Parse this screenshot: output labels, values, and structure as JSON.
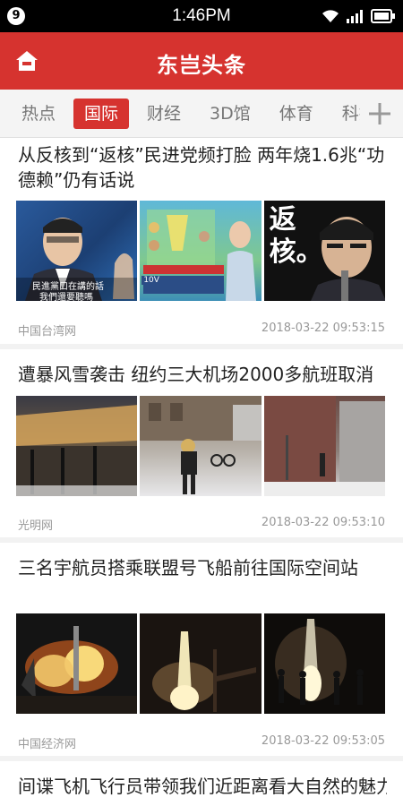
{
  "status_bar": {
    "badge": "9",
    "time": "1:46PM",
    "icons": [
      "wifi-icon",
      "signal-icon",
      "battery-icon"
    ]
  },
  "header": {
    "title": "东岂头条",
    "home_icon": "home-icon",
    "accent_color": "#d6332f"
  },
  "tabs": {
    "items": [
      "热点",
      "国际",
      "财经",
      "3D馆",
      "体育",
      "科技"
    ],
    "active": "国际",
    "add_icon": "plus-icon"
  },
  "feed": [
    {
      "title": "从反核到“返核”民进党频打脸 两年烧1.6兆“功德赖”仍有话说",
      "thumb_text": [
        "民進黨口在講的話",
        "我們還要聽嗎",
        "返核。",
        "10V"
      ],
      "source": "中国台湾网",
      "time": "2018-03-22 09:53:15"
    },
    {
      "title": "遭暴风雪袭击 纽约三大机场2000多航班取消",
      "source": "光明网",
      "time": "2018-03-22 09:53:10"
    },
    {
      "title": "三名宇航员搭乘联盟号飞船前往国际空间站",
      "source": "中国经济网",
      "time": "2018-03-22 09:53:05"
    },
    {
      "title": "间谍飞机飞行员带领我们近距离看大自然的魅力"
    }
  ]
}
